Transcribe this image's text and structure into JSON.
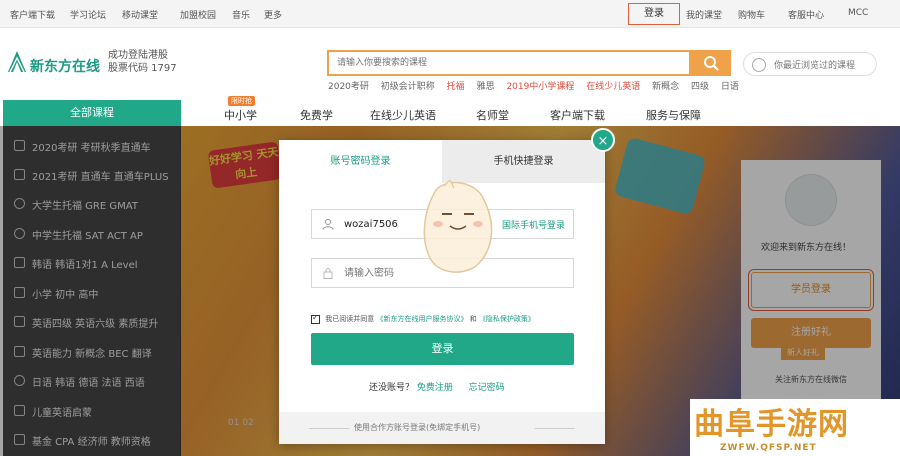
{
  "topbar": {
    "items": [
      "客户端下载",
      "学习论坛",
      "移动课堂",
      "加盟校园",
      "音乐",
      "更多"
    ],
    "login": "登录",
    "right_items": [
      "我的课堂",
      "购物车",
      "客服中心",
      "MCC"
    ]
  },
  "header": {
    "logo_text": "新东方在线",
    "slogan_line1": "成功登陆港股",
    "slogan_line2": "股票代码 1797",
    "search_placeholder": "请输入你要搜索的课程",
    "hotwords": [
      {
        "text": "2020考研",
        "hot": false
      },
      {
        "text": "初级会计职称",
        "hot": false
      },
      {
        "text": "托福",
        "hot": true
      },
      {
        "text": "雅思",
        "hot": false
      },
      {
        "text": "2019中小学课程",
        "hot": true
      },
      {
        "text": "在线少儿英语",
        "hot": true
      },
      {
        "text": "新概念",
        "hot": false
      },
      {
        "text": "四级",
        "hot": false
      },
      {
        "text": "日语",
        "hot": false
      }
    ],
    "history_text": "你最近浏览过的课程"
  },
  "nav": {
    "all_courses": "全部课程",
    "badge": "限时抢",
    "tabs": [
      "中小学",
      "免费学",
      "在线少儿英语",
      "名师堂",
      "客户端下载",
      "服务与保障"
    ]
  },
  "sidebar": {
    "items": [
      "2020考研  考研秋季直通车",
      "2021考研  直通车  直通车PLUS",
      "大学生托福  GRE  GMAT",
      "中学生托福  SAT  ACT  AP",
      "韩语  韩语1对1  A Level",
      "小学  初中  高中",
      "英语四级  英语六级  素质提升",
      "英语能力  新概念  BEC  翻译",
      "日语  韩语  德语  法语  西语",
      "儿童英语启蒙",
      "基金  CPA  经济师  教师资格"
    ]
  },
  "banner": {
    "bubble": "好好学习 天天向上",
    "dots": "01  02"
  },
  "rpanel": {
    "welcome": "欢迎来到新东方在线！",
    "student_login": "学员登录",
    "register": "注册好礼",
    "gift": "新人好礼",
    "more": "关注新东方在线微信"
  },
  "modal": {
    "tab_account": "账号密码登录",
    "tab_phone": "手机快捷登录",
    "close": "×",
    "username_value": "wozai7506",
    "username_switch": "国际手机号登录",
    "password_placeholder": "请输入密码",
    "agree_prefix": "我已阅读并同意",
    "agree_link1": "《新东方在线用户服务协议》",
    "agree_and": "和",
    "agree_link2": "《隐私保护政策》",
    "login_button": "登录",
    "no_account": "还没账号？",
    "register_link": "免费注册",
    "forgot_link": "忘记密码",
    "footer_text": "使用合作方账号登录(免绑定手机号)"
  },
  "watermark": {
    "big": "曲阜手游网",
    "small": "ZWFW.QFSP.NET"
  }
}
